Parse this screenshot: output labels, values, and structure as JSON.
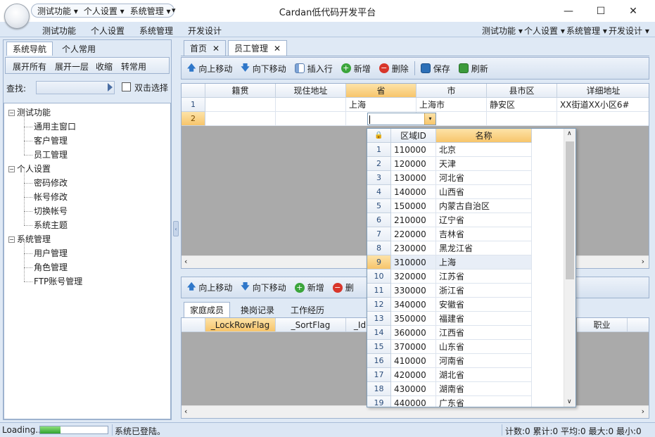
{
  "window": {
    "title": "Cardan低代码开发平台",
    "minimize": "—",
    "maximize": "☐",
    "close": "✕"
  },
  "quick_access": {
    "items": [
      "测试功能 ▾",
      "个人设置 ▾",
      "系统管理 ▾"
    ],
    "more": "▾"
  },
  "ribbon": {
    "tabs": [
      "测试功能",
      "个人设置",
      "系统管理",
      "开发设计"
    ],
    "right_menus": [
      "测试功能 ▾",
      "个人设置 ▾",
      "系统管理 ▾",
      "开发设计 ▾"
    ]
  },
  "left_panel": {
    "tabs": [
      "系统导航",
      "个人常用"
    ],
    "actions": [
      "展开所有",
      "展开一层",
      "收缩",
      "转常用"
    ],
    "search_label": "查找:",
    "search_value": "",
    "dblclick_label": "双击选择",
    "tree": [
      {
        "label": "测试功能",
        "children": [
          "通用主窗口",
          "客户管理",
          "员工管理"
        ]
      },
      {
        "label": "个人设置",
        "children": [
          "密码修改",
          "帐号修改",
          "切换帐号",
          "系统主题"
        ]
      },
      {
        "label": "系统管理",
        "children": [
          "用户管理",
          "角色管理",
          "FTP账号管理"
        ]
      }
    ]
  },
  "doc_tabs": [
    {
      "label": "首页",
      "close": "✕"
    },
    {
      "label": "员工管理",
      "close": "✕"
    }
  ],
  "top_toolbar": [
    "向上移动",
    "向下移动",
    "插入行",
    "新增",
    "删除",
    "保存",
    "刷新"
  ],
  "main_grid": {
    "columns": [
      "籍贯",
      "现住地址",
      "省",
      "市",
      "县市区",
      "详细地址"
    ],
    "rows": [
      {
        "num": "1",
        "cells": [
          "",
          "",
          "上海",
          "上海市",
          "静安区",
          "XX街道XX小区6#"
        ]
      },
      {
        "num": "2",
        "cells": [
          "",
          "",
          "",
          "",
          "",
          ""
        ]
      }
    ]
  },
  "dropdown": {
    "columns": [
      "区域ID",
      "名称"
    ],
    "rows": [
      {
        "num": "1",
        "id": "110000",
        "name": "北京"
      },
      {
        "num": "2",
        "id": "120000",
        "name": "天津"
      },
      {
        "num": "3",
        "id": "130000",
        "name": "河北省"
      },
      {
        "num": "4",
        "id": "140000",
        "name": "山西省"
      },
      {
        "num": "5",
        "id": "150000",
        "name": "内蒙古自治区"
      },
      {
        "num": "6",
        "id": "210000",
        "name": "辽宁省"
      },
      {
        "num": "7",
        "id": "220000",
        "name": "吉林省"
      },
      {
        "num": "8",
        "id": "230000",
        "name": "黑龙江省"
      },
      {
        "num": "9",
        "id": "310000",
        "name": "上海"
      },
      {
        "num": "10",
        "id": "320000",
        "name": "江苏省"
      },
      {
        "num": "11",
        "id": "330000",
        "name": "浙江省"
      },
      {
        "num": "12",
        "id": "340000",
        "name": "安徽省"
      },
      {
        "num": "13",
        "id": "350000",
        "name": "福建省"
      },
      {
        "num": "14",
        "id": "360000",
        "name": "江西省"
      },
      {
        "num": "15",
        "id": "370000",
        "name": "山东省"
      },
      {
        "num": "16",
        "id": "410000",
        "name": "河南省"
      },
      {
        "num": "17",
        "id": "420000",
        "name": "湖北省"
      },
      {
        "num": "18",
        "id": "430000",
        "name": "湖南省"
      },
      {
        "num": "19",
        "id": "440000",
        "name": "广东省"
      }
    ],
    "selected_row": "9"
  },
  "bottom_toolbar": [
    "向上移动",
    "向下移动",
    "新增",
    "删"
  ],
  "bottom_tabs": [
    "家庭成员",
    "换岗记录",
    "工作经历"
  ],
  "bottom_grid": {
    "columns": [
      "_LockRowFlag",
      "_SortFlag",
      "_Id",
      "职业"
    ]
  },
  "statusbar": {
    "loading": "Loading...",
    "progress": 0.3,
    "message": "系统已登陆。",
    "stats": "计数:0 累计:0 平均:0 最大:0 最小:0"
  },
  "colors": {
    "accent": "#f7c56b",
    "ribbon": "#dde8f5",
    "border": "#9db2cf"
  }
}
